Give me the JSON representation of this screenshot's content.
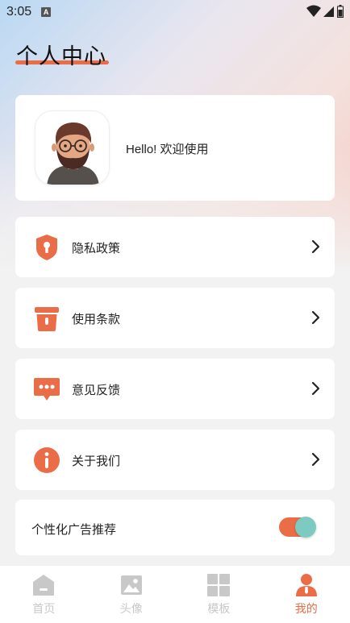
{
  "status_bar": {
    "time": "3:05",
    "notif_letter": "A"
  },
  "page_title": "个人中心",
  "profile": {
    "greeting": "Hello! 欢迎使用"
  },
  "menu": [
    {
      "label": "隐私政策",
      "icon": "shield-lock-icon"
    },
    {
      "label": "使用条款",
      "icon": "trash-bin-icon"
    },
    {
      "label": "意见反馈",
      "icon": "chat-bubble-icon"
    },
    {
      "label": "关于我们",
      "icon": "info-icon"
    }
  ],
  "ad_setting": {
    "label": "个性化广告推荐",
    "enabled": true
  },
  "bottom_nav": [
    {
      "label": "首页",
      "icon": "home-icon",
      "active": false
    },
    {
      "label": "头像",
      "icon": "image-icon",
      "active": false
    },
    {
      "label": "模板",
      "icon": "grid-icon",
      "active": false
    },
    {
      "label": "我的",
      "icon": "person-icon",
      "active": true
    }
  ],
  "colors": {
    "accent": "#ea6d48",
    "toggle_knob": "#7dcac0",
    "inactive": "#c8c8c8"
  }
}
